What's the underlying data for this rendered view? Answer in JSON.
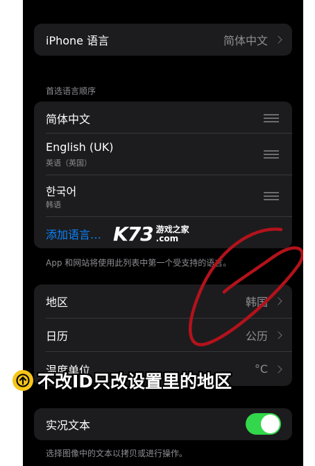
{
  "language_group": {
    "label": "iPhone 语言",
    "value": "简体中文"
  },
  "preferred": {
    "header": "首选语言顺序",
    "items": [
      {
        "label": "简体中文",
        "sub": ""
      },
      {
        "label": "English (UK)",
        "sub": "英语（英国）"
      },
      {
        "label": "한국어",
        "sub": "韩语"
      }
    ],
    "add_label": "添加语言…",
    "footer": "App 和网站将使用此列表中第一个受支持的语言。"
  },
  "region_group": {
    "rows": [
      {
        "label": "地区",
        "value": "韩国"
      },
      {
        "label": "日历",
        "value": "公历"
      },
      {
        "label": "温度单位",
        "value": "°C"
      }
    ]
  },
  "live_text": {
    "label": "实况文本",
    "enabled": true,
    "footer": "选择图像中的文本以拷贝或进行操作。"
  },
  "watermark": {
    "logo": "K73",
    "line1": "游戏之家",
    "line2": ".com"
  },
  "banner": {
    "text": "不改ID只改设置里的地区"
  },
  "colors": {
    "accent_blue": "#0a84ff",
    "toggle_green": "#32d74b",
    "banner_circle": "#f5c518",
    "scribble_red": "#b3121b"
  }
}
